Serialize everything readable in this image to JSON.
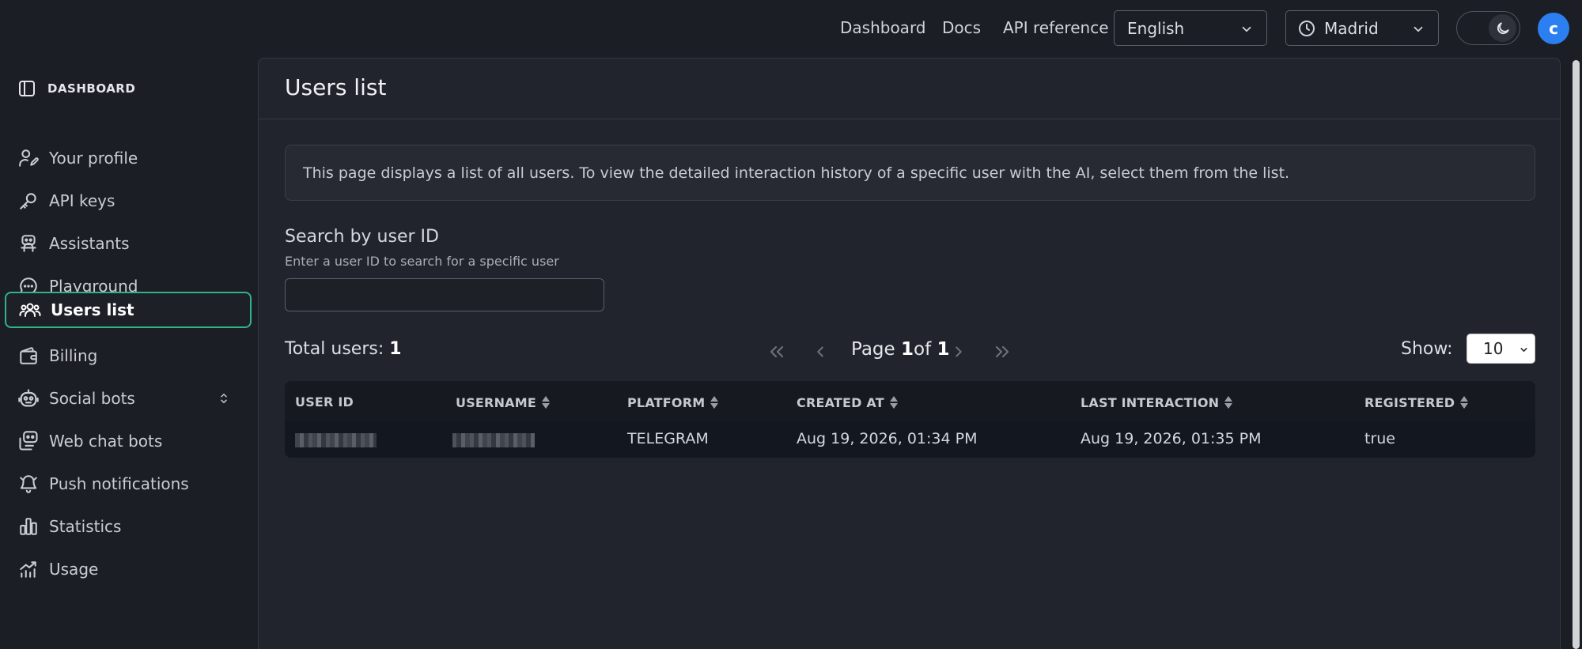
{
  "topbar": {
    "links": {
      "dashboard": "Dashboard",
      "docs": "Docs",
      "api_reference": "API reference"
    },
    "language": "English",
    "timezone": "Madrid",
    "avatar_initial": "c"
  },
  "sidebar": {
    "header": "DASHBOARD",
    "items": [
      {
        "label": "Your profile"
      },
      {
        "label": "API keys"
      },
      {
        "label": "Assistants"
      },
      {
        "label": "Playground"
      },
      {
        "label": "Users list"
      },
      {
        "label": "Billing"
      },
      {
        "label": "Social bots"
      },
      {
        "label": "Web chat bots"
      },
      {
        "label": "Push notifications"
      },
      {
        "label": "Statistics"
      },
      {
        "label": "Usage"
      }
    ]
  },
  "main": {
    "title": "Users list",
    "info": "This page displays a list of all users. To view the detailed interaction history of a specific user with the AI, select them from the list.",
    "search": {
      "label": "Search by user ID",
      "hint": "Enter a user ID to search for a specific user",
      "value": ""
    },
    "total": {
      "label": "Total users:",
      "count": "1"
    },
    "pager": {
      "page_word": "Page",
      "current": "1",
      "of_word": "of",
      "total": "1"
    },
    "show": {
      "label": "Show:",
      "value": "10"
    },
    "table": {
      "headers": [
        "USER ID",
        "USERNAME",
        "PLATFORM",
        "CREATED AT",
        "LAST INTERACTION",
        "REGISTERED"
      ],
      "rows": [
        {
          "platform": "TELEGRAM",
          "created_at": "Aug 19, 2026, 01:34 PM",
          "last_interaction": "Aug 19, 2026, 01:35 PM",
          "registered": "true"
        }
      ]
    }
  },
  "colors": {
    "accent": "#2fb585",
    "avatar": "#2b7ff0",
    "background": "#1c1e25",
    "panel": "#21242c"
  }
}
